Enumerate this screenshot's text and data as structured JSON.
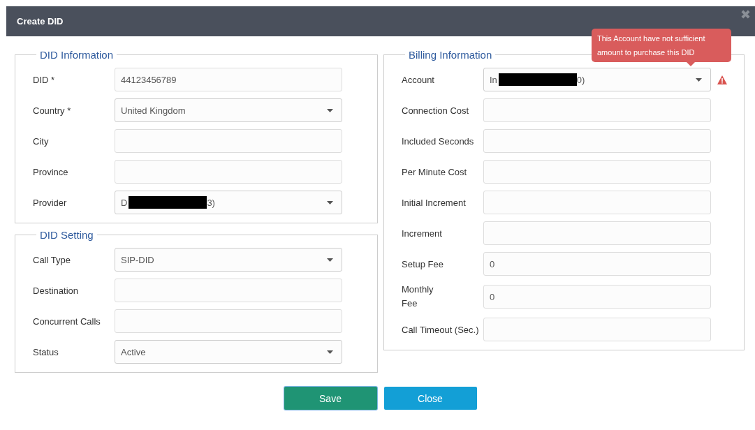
{
  "dialog": {
    "title": "Create DID",
    "close_icon": "✖"
  },
  "columns": [
    {
      "sections": [
        {
          "title": "DID Information",
          "fields": [
            {
              "label": "DID *",
              "kind": "text",
              "value": "44123456789"
            },
            {
              "label": "Country *",
              "kind": "select",
              "value": "United Kingdom"
            },
            {
              "label": "City",
              "kind": "text"
            },
            {
              "label": "Province",
              "kind": "text"
            },
            {
              "label": "Provider",
              "kind": "select",
              "value": "D",
              "value_end": "3)",
              "redacted": true
            }
          ]
        },
        {
          "title": "DID Setting",
          "fields": [
            {
              "label": "Call Type",
              "kind": "select",
              "value": "SIP-DID"
            },
            {
              "label": "Destination",
              "kind": "text"
            },
            {
              "label": "Concurrent Calls",
              "kind": "text"
            },
            {
              "label": "Status",
              "kind": "select",
              "value": "Active"
            }
          ]
        }
      ]
    },
    {
      "sections": [
        {
          "title": "Billing Information",
          "fields": [
            {
              "label": "Account",
              "kind": "select",
              "value": "In",
              "value_end": "0)",
              "redacted": true,
              "error": true
            },
            {
              "label": "Connection Cost",
              "kind": "text"
            },
            {
              "label": "Included Seconds",
              "kind": "text"
            },
            {
              "label": "Per Minute Cost",
              "kind": "text"
            },
            {
              "label": "Initial Increment",
              "kind": "text"
            },
            {
              "label": "Increment",
              "kind": "text"
            },
            {
              "label": "Setup Fee",
              "kind": "text",
              "value": "0"
            },
            {
              "label": "Monthly Fee",
              "kind": "text",
              "value": "0",
              "wrapped": true
            },
            {
              "label": "Call Timeout (Sec.)",
              "kind": "text"
            }
          ]
        }
      ]
    }
  ],
  "tooltip": {
    "text": "This Account have not sufficient amount to purchase this DID"
  },
  "buttons": [
    {
      "label": "Save",
      "kind": "primary"
    },
    {
      "label": "Close",
      "kind": "secondary"
    }
  ]
}
